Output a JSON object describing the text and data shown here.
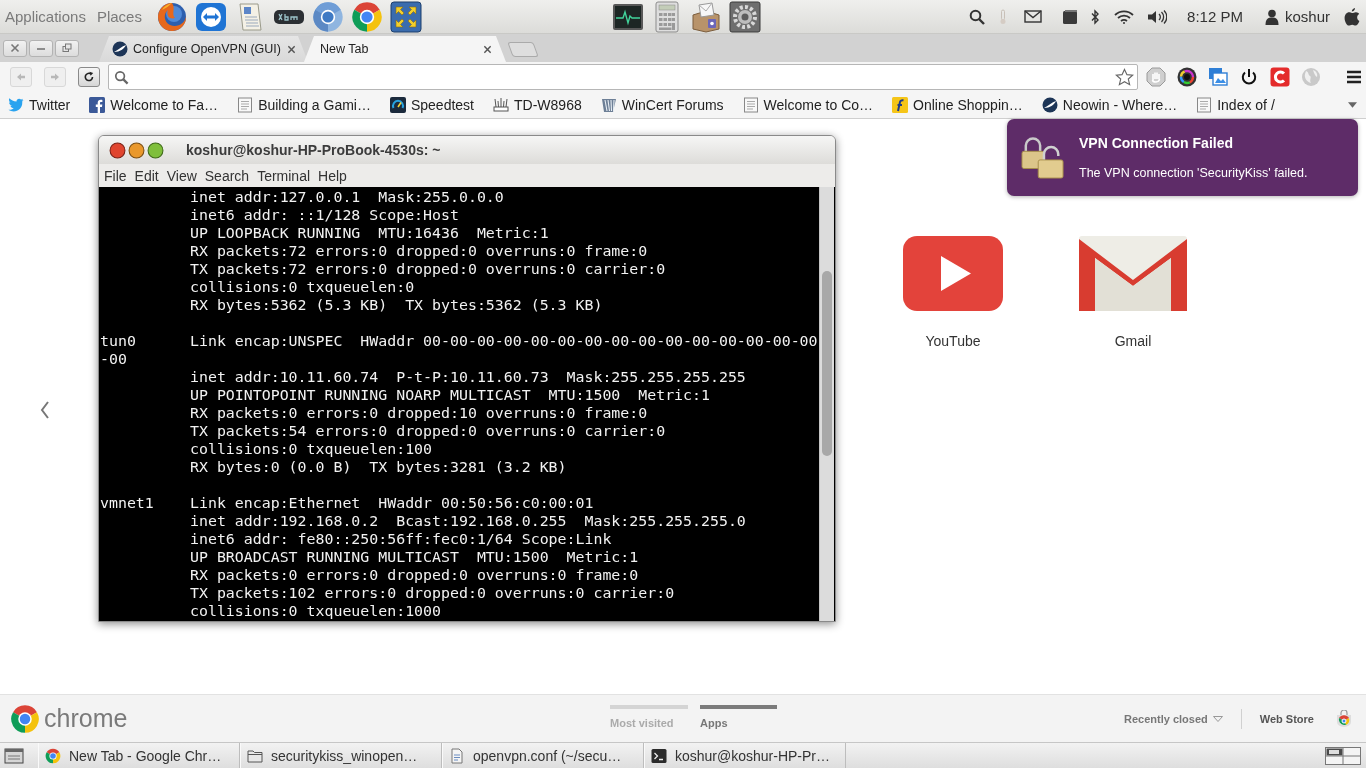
{
  "top_panel": {
    "menus": [
      "Applications",
      "Places"
    ],
    "clock": "8:12 PM",
    "user": "koshur"
  },
  "browser": {
    "tabs": [
      {
        "title": "Configure OpenVPN (GUI)",
        "selected": false
      },
      {
        "title": "New Tab",
        "selected": true
      }
    ],
    "navigation": [
      {
        "kind": "back",
        "disabled": true
      },
      {
        "kind": "forward",
        "disabled": true
      },
      {
        "kind": "reload",
        "disabled": false
      }
    ],
    "bookmarks": [
      {
        "label": "Twitter",
        "kind": "twitter"
      },
      {
        "label": "Welcome to Fa…",
        "kind": "facebook"
      },
      {
        "label": "Building a Gami…",
        "kind": "page"
      },
      {
        "label": "Speedtest",
        "kind": "gauge"
      },
      {
        "label": "TD-W8968",
        "kind": "router"
      },
      {
        "label": "WinCert Forums",
        "kind": "stripes"
      },
      {
        "label": "Welcome to Co…",
        "kind": "page"
      },
      {
        "label": "Online Shoppin…",
        "kind": "shop"
      },
      {
        "label": "Neowin - Where…",
        "kind": "swoosh"
      },
      {
        "label": "Index of /",
        "kind": "page"
      }
    ]
  },
  "new_tab_page": {
    "apps": [
      {
        "label": "YouTube",
        "kind": "youtube"
      },
      {
        "label": "Gmail",
        "kind": "gmail"
      }
    ],
    "footer": {
      "brand": "chrome",
      "pages": [
        {
          "label": "Most visited",
          "selected": false
        },
        {
          "label": "Apps",
          "selected": true
        }
      ],
      "recently_closed": "Recently closed",
      "web_store": "Web Store"
    }
  },
  "terminal": {
    "title": "koshur@koshur-HP-ProBook-4530s: ~",
    "menu": [
      "File",
      "Edit",
      "View",
      "Search",
      "Terminal",
      "Help"
    ],
    "lines": [
      {
        "kind": "detail",
        "text": "inet addr:127.0.0.1  Mask:255.0.0.0"
      },
      {
        "kind": "detail",
        "text": "inet6 addr: ::1/128 Scope:Host"
      },
      {
        "kind": "detail",
        "text": "UP LOOPBACK RUNNING  MTU:16436  Metric:1"
      },
      {
        "kind": "detail",
        "text": "RX packets:72 errors:0 dropped:0 overruns:0 frame:0"
      },
      {
        "kind": "detail",
        "text": "TX packets:72 errors:0 dropped:0 overruns:0 carrier:0"
      },
      {
        "kind": "detail",
        "text": "collisions:0 txqueuelen:0"
      },
      {
        "kind": "detail",
        "text": "RX bytes:5362 (5.3 KB)  TX bytes:5362 (5.3 KB)"
      },
      {
        "kind": "blank"
      },
      {
        "kind": "interface",
        "name": "tun0",
        "text": "Link encap:UNSPEC  HWaddr 00-00-00-00-00-00-00-00-00-00-00-00-00-00-00"
      },
      {
        "kind": "wrap",
        "text": "-00"
      },
      {
        "kind": "detail",
        "text": "inet addr:10.11.60.74  P-t-P:10.11.60.73  Mask:255.255.255.255"
      },
      {
        "kind": "detail",
        "text": "UP POINTOPOINT RUNNING NOARP MULTICAST  MTU:1500  Metric:1"
      },
      {
        "kind": "detail",
        "text": "RX packets:0 errors:0 dropped:10 overruns:0 frame:0"
      },
      {
        "kind": "detail",
        "text": "TX packets:54 errors:0 dropped:0 overruns:0 carrier:0"
      },
      {
        "kind": "detail",
        "text": "collisions:0 txqueuelen:100"
      },
      {
        "kind": "detail",
        "text": "RX bytes:0 (0.0 B)  TX bytes:3281 (3.2 KB)"
      },
      {
        "kind": "blank"
      },
      {
        "kind": "interface",
        "name": "vmnet1",
        "text": "Link encap:Ethernet  HWaddr 00:50:56:c0:00:01"
      },
      {
        "kind": "detail",
        "text": "inet addr:192.168.0.2  Bcast:192.168.0.255  Mask:255.255.255.0"
      },
      {
        "kind": "detail",
        "text": "inet6 addr: fe80::250:56ff:fec0:1/64 Scope:Link"
      },
      {
        "kind": "detail",
        "text": "UP BROADCAST RUNNING MULTICAST  MTU:1500  Metric:1"
      },
      {
        "kind": "detail",
        "text": "RX packets:0 errors:0 dropped:0 overruns:0 frame:0"
      },
      {
        "kind": "detail",
        "text": "TX packets:102 errors:0 dropped:0 overruns:0 carrier:0"
      },
      {
        "kind": "detail",
        "text": "collisions:0 txqueuelen:1000"
      }
    ]
  },
  "notification": {
    "title": "VPN Connection Failed",
    "body": "The VPN connection 'SecurityKiss' failed."
  },
  "taskbar": {
    "items": [
      {
        "label": "New Tab - Google Chr…",
        "kind": "chrome"
      },
      {
        "label": "securitykiss_winopen…",
        "kind": "folder"
      },
      {
        "label": "openvpn.conf (~/secu…",
        "kind": "document"
      },
      {
        "label": "koshur@koshur-HP-Pr…",
        "kind": "terminal"
      }
    ]
  }
}
